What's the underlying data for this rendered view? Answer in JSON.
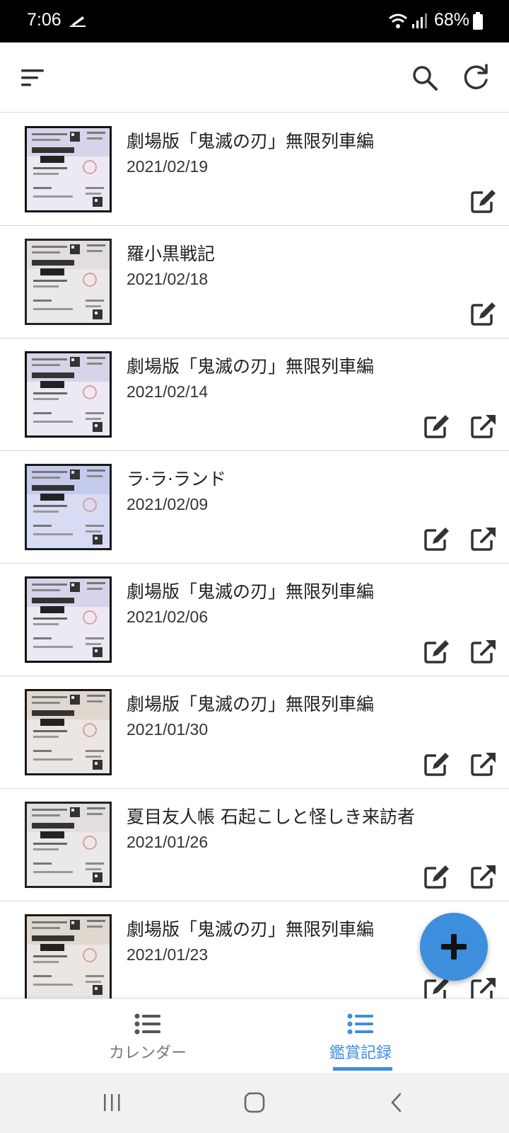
{
  "status_bar": {
    "time": "7:06",
    "battery": "68%"
  },
  "app_bar": {
    "icons": [
      "sort-icon",
      "search-icon",
      "refresh-icon"
    ]
  },
  "records": [
    {
      "title": "劇場版「鬼滅の刃」無限列車編",
      "date": "2021/02/19",
      "actions": [
        "edit"
      ],
      "ticket_style": "dark"
    },
    {
      "title": "羅小黒戦記",
      "date": "2021/02/18",
      "actions": [
        "edit"
      ],
      "ticket_style": "light"
    },
    {
      "title": "劇場版「鬼滅の刃」無限列車編",
      "date": "2021/02/14",
      "actions": [
        "edit",
        "open"
      ],
      "ticket_style": "dark"
    },
    {
      "title": "ラ·ラ·ランド",
      "date": "2021/02/09",
      "actions": [
        "edit",
        "open"
      ],
      "ticket_style": "blue"
    },
    {
      "title": "劇場版「鬼滅の刃」無限列車編",
      "date": "2021/02/06",
      "actions": [
        "edit",
        "open"
      ],
      "ticket_style": "dark"
    },
    {
      "title": "劇場版「鬼滅の刃」無限列車編",
      "date": "2021/01/30",
      "actions": [
        "edit",
        "open"
      ],
      "ticket_style": "warm"
    },
    {
      "title": "夏目友人帳 石起こしと怪しき来訪者",
      "date": "2021/01/26",
      "actions": [
        "edit",
        "open"
      ],
      "ticket_style": "light"
    },
    {
      "title": "劇場版「鬼滅の刃」無限列車編",
      "date": "2021/01/23",
      "actions": [
        "edit",
        "open"
      ],
      "ticket_style": "warm"
    }
  ],
  "fab": {
    "icon": "plus-icon"
  },
  "bottom_nav": {
    "calendar_label": "カレンダー",
    "records_label": "鑑賞記録",
    "active": "records"
  },
  "colors": {
    "accent": "#3d8fde",
    "icon": "#333333"
  }
}
